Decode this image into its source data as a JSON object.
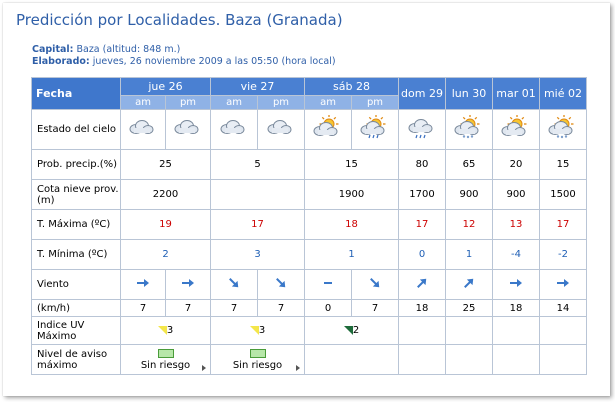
{
  "title": "Predicción por Localidades. Baza (Granada)",
  "capital": {
    "label": "Capital:",
    "value": "Baza (altitud: 848 m.)"
  },
  "elaborado": {
    "label": "Elaborado:",
    "value": "jueves, 26 noviembre 2009 a las 05:50 (hora local)"
  },
  "table": {
    "fecha_label": "Fecha",
    "am": "am",
    "pm": "pm",
    "days": [
      "jue 26",
      "vie 27",
      "sáb 28",
      "dom 29",
      "lun 30",
      "mar 01",
      "mié 02"
    ],
    "row_labels": {
      "estado": "Estado del cielo",
      "prob": "Prob. precip.(%)",
      "cota": "Cota nieve prov.(m)",
      "tmax": "T. Máxima (ºC)",
      "tmin": "T. Mínima (ºC)",
      "viento": "Viento",
      "kmh": "(km/h)",
      "uv": "Indice UV Máximo",
      "aviso": "Nivel de aviso máximo"
    },
    "sky_icons": [
      "cloudy-icon",
      "cloudy-icon",
      "cloudy-icon",
      "cloudy-icon",
      "sun-cloud-icon",
      "sun-cloud-rain-icon",
      "cloud-rain-icon",
      "sun-cloud-snow-icon",
      "sun-cloud-icon",
      "sun-cloud-snow-icon"
    ],
    "prob": [
      "25",
      "5",
      "15",
      "80",
      "65",
      "20",
      "15"
    ],
    "cota": [
      "2200",
      "",
      "1900",
      "1700",
      "900",
      "900",
      "1500"
    ],
    "tmax": [
      "19",
      "17",
      "18",
      "17",
      "12",
      "13",
      "17"
    ],
    "tmin": [
      "2",
      "3",
      "1",
      "0",
      "1",
      "-4",
      "-2"
    ],
    "wind_dirs": [
      "E",
      "E",
      "SE",
      "SE",
      "calm",
      "SE",
      "NE",
      "NE",
      "E",
      "E"
    ],
    "wind_speed": [
      "7",
      "7",
      "7",
      "7",
      "0",
      "7",
      "18",
      "25",
      "18",
      "14"
    ],
    "uv": [
      "3",
      "3",
      "2"
    ],
    "aviso_label": "Sin riesgo",
    "colors": {
      "header": "#3f77cc",
      "subheader": "#8fb2e6",
      "title": "#2f5fa8",
      "tmax": "#cc0000",
      "tmin": "#1f5fb5",
      "arrow": "#3a78c9"
    }
  }
}
